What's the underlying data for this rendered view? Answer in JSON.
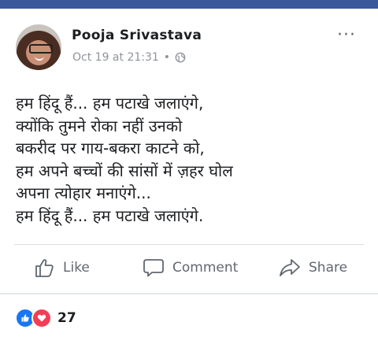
{
  "post": {
    "author": "Pooja Srivastava",
    "timestamp": "Oct 19 at 21:31",
    "separator": "•",
    "privacy_icon": "globe-icon",
    "more_icon": "more-options-icon",
    "text_lines": [
      "हम हिंदू हैं... हम पटाखे जलाएंगे,",
      "क्योंकि तुमने रोका नहीं उनको",
      "बकरीद पर गाय-बकरा काटने को,",
      "हम अपने बच्चों की सांसों में ज़हर घोल",
      "अपना त्योहार मनाएंगे...",
      "हम हिंदू हैं... हम पटाखे जलाएंगे."
    ]
  },
  "actions": {
    "like": "Like",
    "comment": "Comment",
    "share": "Share"
  },
  "reactions": {
    "count": "27",
    "types": [
      "like",
      "love"
    ]
  },
  "colors": {
    "brand": "#3b5998",
    "like": "#1877f2",
    "love": "#f33e58",
    "muted": "#606770"
  }
}
